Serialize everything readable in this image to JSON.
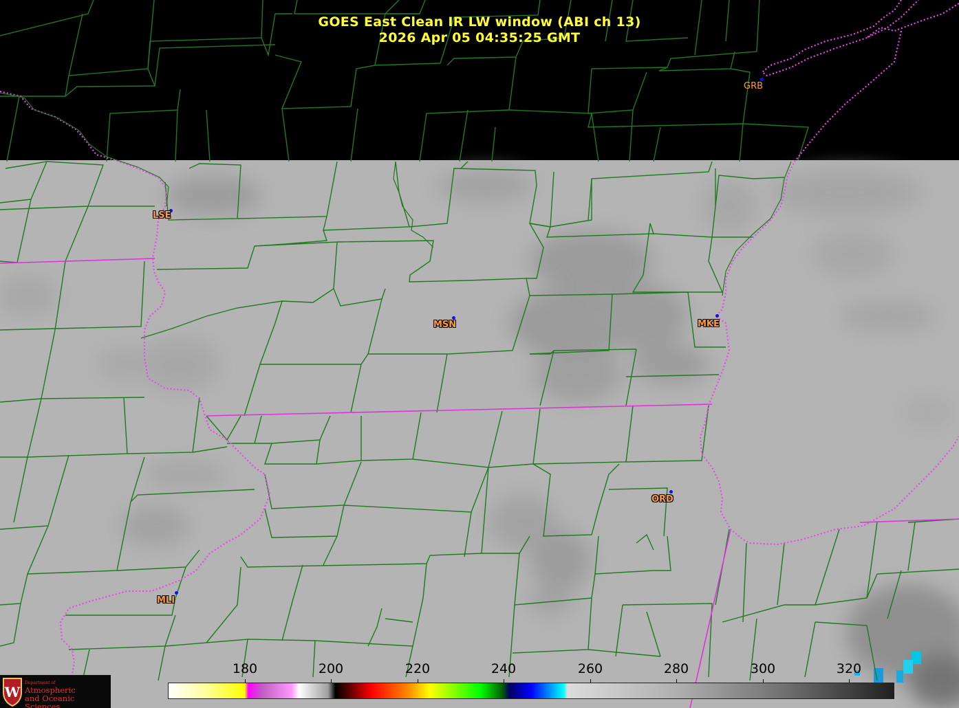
{
  "title": {
    "line1": "GOES East Clean IR LW window (ABI ch 13)",
    "line2": "2026 Apr 05  04:35:25 GMT"
  },
  "stations": [
    {
      "id": "GRB",
      "name": "map-station-grb"
    },
    {
      "id": "LSE",
      "name": "map-station-lse"
    },
    {
      "id": "MSN",
      "name": "map-station-msn"
    },
    {
      "id": "MKE",
      "name": "map-station-mke"
    },
    {
      "id": "ORD",
      "name": "map-station-ord"
    },
    {
      "id": "MLI",
      "name": "map-station-mli"
    }
  ],
  "colorbar": {
    "ticks": [
      "180",
      "200",
      "220",
      "240",
      "260",
      "280",
      "300",
      "320"
    ]
  },
  "logo": {
    "dept": "Department of",
    "line1": "Atmospheric",
    "line2": "and Oceanic Sciences"
  },
  "colors": {
    "title": "#ffff33",
    "county_lines": "#1f7a1f",
    "state_lines": "#dd33dd",
    "station_label": "#ff9a3c",
    "station_dot": "#1010ee",
    "cloud_base": "#b4b4b4"
  }
}
